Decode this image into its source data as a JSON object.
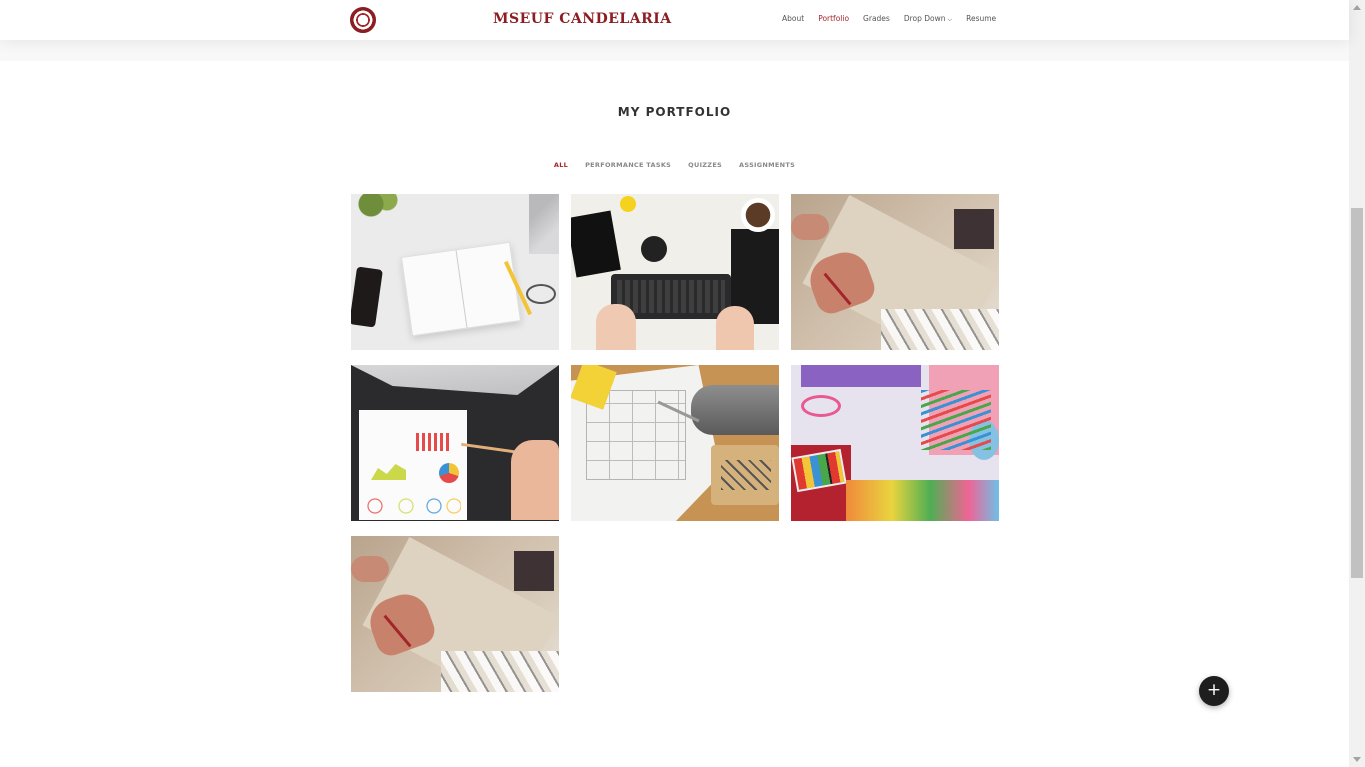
{
  "header": {
    "brand": "MSEUF CANDELARIA",
    "nav": [
      {
        "label": "About",
        "active": false
      },
      {
        "label": "Portfolio",
        "active": true
      },
      {
        "label": "Grades",
        "active": false
      },
      {
        "label": "Drop Down",
        "active": false
      },
      {
        "label": "Resume",
        "active": false
      }
    ],
    "accent_color": "#a3252a"
  },
  "section": {
    "title": "MY PORTFOLIO",
    "filters": [
      {
        "label": "ALL",
        "active": true
      },
      {
        "label": "PERFORMANCE TASKS",
        "active": false
      },
      {
        "label": "QUIZZES",
        "active": false
      },
      {
        "label": "ASSIGNMENTS",
        "active": false
      }
    ]
  },
  "portfolio_items": [
    {
      "image": "notebook-desk"
    },
    {
      "image": "keyboard-creative-mess"
    },
    {
      "image": "hand-drawing"
    },
    {
      "image": "charts-paper"
    },
    {
      "image": "blueprint-drill"
    },
    {
      "image": "art-supplies"
    },
    {
      "image": "hand-drawing"
    }
  ],
  "fab": {
    "icon": "plus-icon",
    "glyph": "+"
  }
}
